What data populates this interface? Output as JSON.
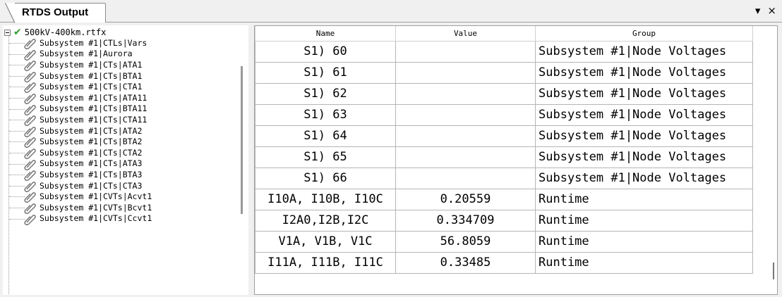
{
  "window": {
    "tab_title": "RTDS Output",
    "dropdown_glyph": "▾",
    "close_glyph": "×"
  },
  "tree": {
    "root_label": "500kV-400km.rtfx",
    "items": [
      "Subsystem #1|CTLs|Vars",
      "Subsystem #1|Aurora",
      "Subsystem #1|CTs|ATA1",
      "Subsystem #1|CTs|BTA1",
      "Subsystem #1|CTs|CTA1",
      "Subsystem #1|CTs|ATA11",
      "Subsystem #1|CTs|BTA11",
      "Subsystem #1|CTs|CTA11",
      "Subsystem #1|CTs|ATA2",
      "Subsystem #1|CTs|BTA2",
      "Subsystem #1|CTs|CTA2",
      "Subsystem #1|CTs|ATA3",
      "Subsystem #1|CTs|BTA3",
      "Subsystem #1|CTs|CTA3",
      "Subsystem #1|CVTs|Acvt1",
      "Subsystem #1|CVTs|Bcvt1",
      "Subsystem #1|CVTs|Ccvt1"
    ]
  },
  "table": {
    "headers": [
      "Name",
      "Value",
      "Group"
    ],
    "rows": [
      {
        "name": "S1) 60",
        "value": "",
        "group": "Subsystem #1|Node Voltages"
      },
      {
        "name": "S1) 61",
        "value": "",
        "group": "Subsystem #1|Node Voltages"
      },
      {
        "name": "S1) 62",
        "value": "",
        "group": "Subsystem #1|Node Voltages"
      },
      {
        "name": "S1) 63",
        "value": "",
        "group": "Subsystem #1|Node Voltages"
      },
      {
        "name": "S1) 64",
        "value": "",
        "group": "Subsystem #1|Node Voltages"
      },
      {
        "name": "S1) 65",
        "value": "",
        "group": "Subsystem #1|Node Voltages"
      },
      {
        "name": "S1) 66",
        "value": "",
        "group": "Subsystem #1|Node Voltages"
      },
      {
        "name": "I10A, I10B, I10C",
        "value": "0.20559",
        "group": "Runtime"
      },
      {
        "name": "I2A0,I2B,I2C",
        "value": "0.334709",
        "group": "Runtime"
      },
      {
        "name": "V1A, V1B, V1C",
        "value": "56.8059",
        "group": "Runtime"
      },
      {
        "name": "I11A, I11B, I11C",
        "value": "0.33485",
        "group": "Runtime"
      }
    ]
  },
  "colors": {
    "check": "#2e9e2e",
    "background": "#f0f0f0"
  }
}
